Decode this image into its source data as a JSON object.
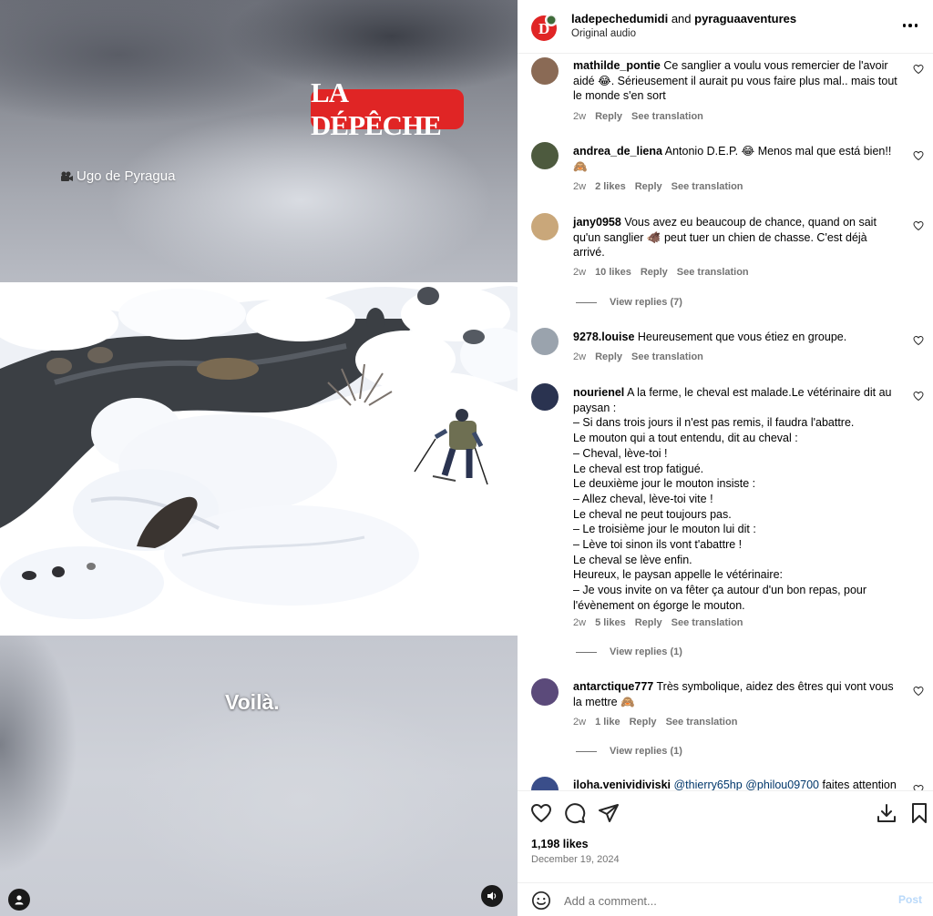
{
  "media": {
    "logo_text": "LA DÉPÊCHE",
    "credit_text": "Ugo de Pyragua",
    "subtitle_text": "Voilà."
  },
  "header": {
    "author1": "ladepechedumidi",
    "and_text": " and ",
    "author2": "pyraguaaventures",
    "audio_text": "Original audio"
  },
  "comments": [
    {
      "user": "mathilde_pontie",
      "text": "Ce sanglier a voulu vous remercier de l'avoir aidé 😂. Sérieusement il aurait pu vous faire plus mal.. mais tout le monde s'en sort",
      "time": "2w",
      "likes": "",
      "reply": "Reply",
      "translate": "See translation",
      "avatar_color": "#8a6a55"
    },
    {
      "user": "andrea_de_liena",
      "text": "Antonio D.E.P. 😂 Menos mal que está bien!! 🙈",
      "time": "2w",
      "likes": "2 likes",
      "reply": "Reply",
      "translate": "See translation",
      "avatar_color": "#4d5a3e"
    },
    {
      "user": "jany0958",
      "text": "Vous avez eu beaucoup de chance, quand on sait qu'un sanglier 🐗 peut tuer un chien de chasse. C'est déjà arrivé.",
      "time": "2w",
      "likes": "10 likes",
      "reply": "Reply",
      "translate": "See translation",
      "replies": "View replies (7)",
      "avatar_color": "#c9a77a"
    },
    {
      "user": "9278.louise",
      "text": "Heureusement que vous étiez en groupe.",
      "time": "2w",
      "likes": "",
      "reply": "Reply",
      "translate": "See translation",
      "avatar_color": "#9aa3ad"
    },
    {
      "user": "nourienel",
      "text": "A la ferme, le cheval est malade.Le vétérinaire dit au paysan :\n– Si dans trois jours il n'est pas remis, il faudra l'abattre.\nLe mouton qui a tout entendu, dit au cheval :\n– Cheval, lève-toi !\nLe cheval est trop fatigué.\nLe deuxième jour le mouton insiste :\n– Allez cheval, lève-toi vite !\nLe cheval ne peut toujours pas.\n– Le troisième jour le mouton lui dit :\n– Lève toi sinon ils vont t'abattre !\nLe cheval se lève enfin.\nHeureux, le paysan appelle le vétérinaire:\n– Je vous invite on va fêter ça autour d'un bon repas, pour l'évènement on égorge le mouton.",
      "time": "2w",
      "likes": "5 likes",
      "reply": "Reply",
      "translate": "See translation",
      "replies": "View replies (1)",
      "avatar_color": "#2a3350"
    },
    {
      "user": "antarctique777",
      "text": "Très symbolique, aidez des êtres qui vont vous la mettre 🙈",
      "time": "2w",
      "likes": "1 like",
      "reply": "Reply",
      "translate": "See translation",
      "replies": "View replies (1)",
      "avatar_color": "#5b4a7a"
    },
    {
      "user": "iloha.venividiviski",
      "mention1": "@thierry65hp",
      "mention2": "@philou09700",
      "text": "faites attention",
      "avatar_color": "#3a4e8a"
    }
  ],
  "actions": {
    "likes_text": "1,198 likes",
    "date_text": "December 19, 2024"
  },
  "add_comment": {
    "placeholder": "Add a comment...",
    "post_label": "Post"
  }
}
